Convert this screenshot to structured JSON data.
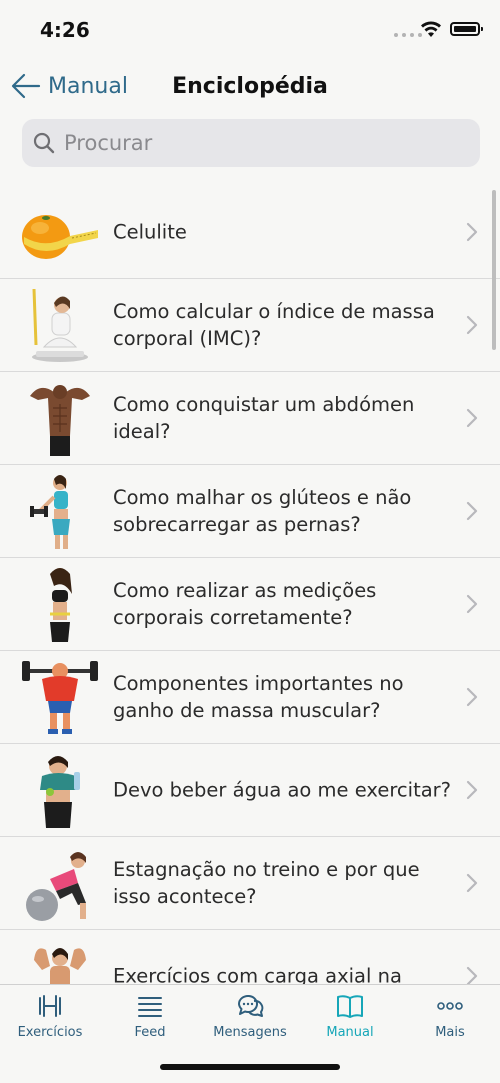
{
  "status": {
    "time": "4:26"
  },
  "nav": {
    "back_label": "Manual",
    "title": "Enciclopédia"
  },
  "search": {
    "placeholder": "Procurar"
  },
  "items": [
    {
      "label": "Celulite",
      "thumb": "orange-measuring-tape"
    },
    {
      "label": "Como calcular o índice de massa corporal (IMC)?",
      "thumb": "woman-on-scale"
    },
    {
      "label": "Como conquistar um abdómen ideal?",
      "thumb": "man-abs"
    },
    {
      "label": "Como malhar os glúteos e não sobrecarregar as pernas?",
      "thumb": "woman-dumbbell"
    },
    {
      "label": "Como realizar as medições corporais corretamente?",
      "thumb": "woman-measuring-waist"
    },
    {
      "label": "Componentes importantes no ganho de massa muscular?",
      "thumb": "cartoon-bodybuilder"
    },
    {
      "label": "Devo beber água ao me exercitar?",
      "thumb": "woman-water-bottle"
    },
    {
      "label": "Estagnação no treino e por que isso acontece?",
      "thumb": "woman-exercise-ball"
    },
    {
      "label": "Exercícios com carga axial na",
      "thumb": "woman-flexing"
    }
  ],
  "tabs": [
    {
      "label": "Exercícios",
      "icon": "dumbbell-icon",
      "active": false
    },
    {
      "label": "Feed",
      "icon": "feed-lines-icon",
      "active": false
    },
    {
      "label": "Mensagens",
      "icon": "chat-bubbles-icon",
      "active": false
    },
    {
      "label": "Manual",
      "icon": "book-icon",
      "active": true
    },
    {
      "label": "Mais",
      "icon": "more-dots-icon",
      "active": false
    }
  ],
  "colors": {
    "accent": "#16a6b8",
    "tab_inactive": "#2f5e7c",
    "back_link": "#2f6a8a",
    "background": "#f7f7f5"
  }
}
